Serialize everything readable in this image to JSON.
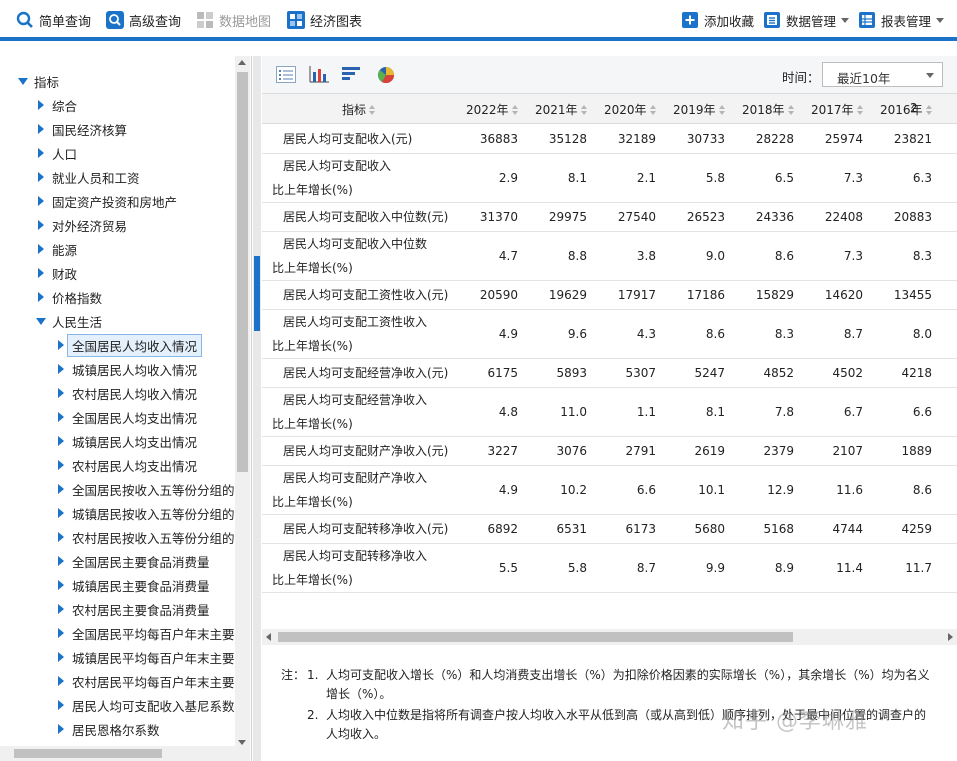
{
  "topnav": {
    "items": [
      {
        "label": "简单查询",
        "icon": "search-icon"
      },
      {
        "label": "高级查询",
        "icon": "advanced-search-icon"
      },
      {
        "label": "数据地图",
        "icon": "map-icon",
        "disabled": true
      },
      {
        "label": "经济图表",
        "icon": "chart-grid-icon"
      }
    ],
    "right": [
      {
        "label": "添加收藏",
        "icon": "plus-icon"
      },
      {
        "label": "数据管理",
        "icon": "data-manage-icon"
      },
      {
        "label": "报表管理",
        "icon": "report-icon"
      }
    ],
    "accent": "#1a73c8"
  },
  "sidebar": {
    "root": "指标",
    "categories": [
      "综合",
      "国民经济核算",
      "人口",
      "就业人员和工资",
      "固定资产投资和房地产",
      "对外经济贸易",
      "能源",
      "财政",
      "价格指数"
    ],
    "expanded": "人民生活",
    "children": [
      "全国居民人均收入情况",
      "城镇居民人均收入情况",
      "农村居民人均收入情况",
      "全国居民人均支出情况",
      "城镇居民人均支出情况",
      "农村居民人均支出情况",
      "全国居民按收入五等份分组的收",
      "城镇居民按收入五等份分组的收",
      "农村居民按收入五等份分组的收",
      "全国居民主要食品消费量",
      "城镇居民主要食品消费量",
      "农村居民主要食品消费量",
      "全国居民平均每百户年末主要耐",
      "城镇居民平均每百户年末主要耐",
      "农村居民平均每百户年末主要耐",
      "居民人均可支配收入基尼系数",
      "居民恩格尔系数"
    ]
  },
  "toolbar": {
    "icons": [
      "table-view-icon",
      "bar-chart-icon",
      "horizontal-bar-icon",
      "pie-chart-icon"
    ],
    "time_label": "时间：",
    "time_value": "最近10年"
  },
  "table": {
    "header_label": "指标",
    "years": [
      "2022年",
      "2021年",
      "2020年",
      "2019年",
      "2018年",
      "2017年",
      "2016年",
      "2"
    ],
    "rows": [
      {
        "l1": "居民人均可支配收入(元)",
        "l2": "",
        "values": [
          "36883",
          "35128",
          "32189",
          "30733",
          "28228",
          "25974",
          "23821"
        ]
      },
      {
        "l1": "居民人均可支配收入",
        "l2": "比上年增长(%)",
        "values": [
          "2.9",
          "8.1",
          "2.1",
          "5.8",
          "6.5",
          "7.3",
          "6.3"
        ]
      },
      {
        "l1": "居民人均可支配收入中位数(元)",
        "l2": "",
        "values": [
          "31370",
          "29975",
          "27540",
          "26523",
          "24336",
          "22408",
          "20883"
        ]
      },
      {
        "l1": "居民人均可支配收入中位数",
        "l2": "比上年增长(%)",
        "values": [
          "4.7",
          "8.8",
          "3.8",
          "9.0",
          "8.6",
          "7.3",
          "8.3"
        ]
      },
      {
        "l1": "居民人均可支配工资性收入(元)",
        "l2": "",
        "values": [
          "20590",
          "19629",
          "17917",
          "17186",
          "15829",
          "14620",
          "13455"
        ]
      },
      {
        "l1": "居民人均可支配工资性收入",
        "l2": "比上年增长(%)",
        "values": [
          "4.9",
          "9.6",
          "4.3",
          "8.6",
          "8.3",
          "8.7",
          "8.0"
        ]
      },
      {
        "l1": "居民人均可支配经营净收入(元)",
        "l2": "",
        "values": [
          "6175",
          "5893",
          "5307",
          "5247",
          "4852",
          "4502",
          "4218"
        ]
      },
      {
        "l1": "居民人均可支配经营净收入",
        "l2": "比上年增长(%)",
        "values": [
          "4.8",
          "11.0",
          "1.1",
          "8.1",
          "7.8",
          "6.7",
          "6.6"
        ]
      },
      {
        "l1": "居民人均可支配财产净收入(元)",
        "l2": "",
        "values": [
          "3227",
          "3076",
          "2791",
          "2619",
          "2379",
          "2107",
          "1889"
        ]
      },
      {
        "l1": "居民人均可支配财产净收入",
        "l2": "比上年增长(%)",
        "values": [
          "4.9",
          "10.2",
          "6.6",
          "10.1",
          "12.9",
          "11.6",
          "8.6"
        ]
      },
      {
        "l1": "居民人均可支配转移净收入(元)",
        "l2": "",
        "values": [
          "6892",
          "6531",
          "6173",
          "5680",
          "5168",
          "4744",
          "4259"
        ]
      },
      {
        "l1": "居民人均可支配转移净收入",
        "l2": "比上年增长(%)",
        "values": [
          "5.5",
          "5.8",
          "8.7",
          "9.9",
          "8.9",
          "11.4",
          "11.7"
        ]
      }
    ]
  },
  "notes": {
    "prefix": "注：",
    "items": [
      {
        "num": "1.",
        "text": "人均可支配收入增长（%）和人均消费支出增长（%）为扣除价格因素的实际增长（%），其余增长（%）均为名义增长（%）。"
      },
      {
        "num": "2.",
        "text": "人均收入中位数是指将所有调查户按人均收入水平从低到高（或从高到低）顺序排列，处于最中间位置的调查户的人均收入。"
      }
    ]
  },
  "watermark": "知乎 @李琳雅"
}
